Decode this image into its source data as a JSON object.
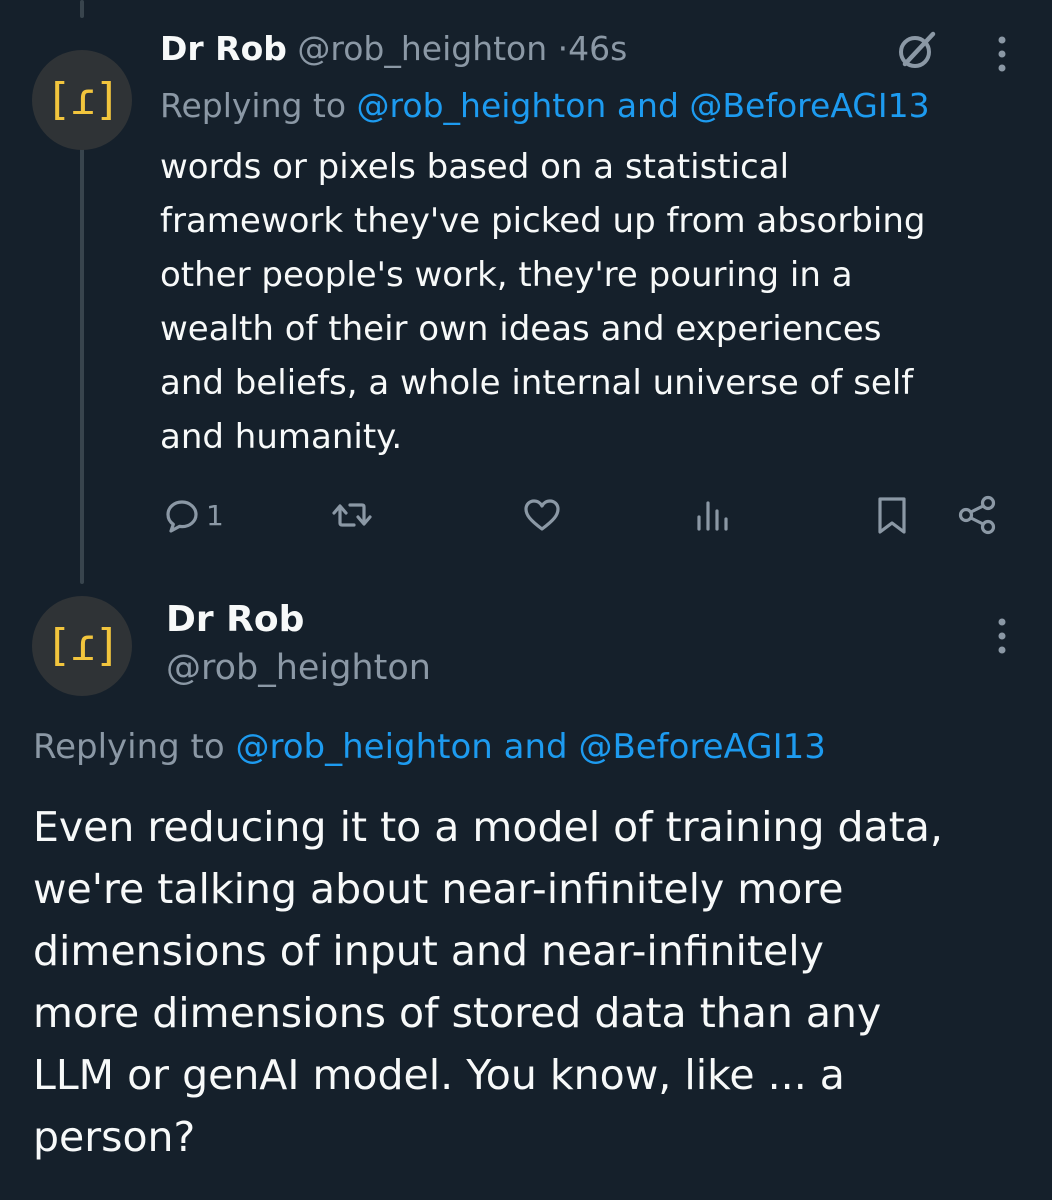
{
  "tweet1": {
    "avatar_text": "[ɾ]",
    "display_name": "Dr Rob",
    "handle": "@rob_heighton",
    "separator": "·",
    "timestamp": "46s",
    "replying_prefix": "Replying to",
    "replying_user1": "@rob_heighton",
    "replying_and": "and",
    "replying_user2": "@BeforeAGI13",
    "body_lines": [
      "words or pixels based on a statistical",
      "framework they've picked up from absorbing",
      "other people's work, they're pouring in a",
      "wealth of their own ideas and experiences",
      "and beliefs, a whole internal universe of self",
      "and humanity."
    ],
    "actions": {
      "reply_count": "1",
      "retweet_count": "",
      "like_count": "",
      "views_count": ""
    }
  },
  "tweet2": {
    "avatar_text": "[ɾ]",
    "display_name": "Dr Rob",
    "handle": "@rob_heighton",
    "replying_prefix": "Replying to",
    "replying_user1": "@rob_heighton",
    "replying_and": "and",
    "replying_user2": "@BeforeAGI13",
    "body_lines": [
      "Even reducing it to a model of training data,",
      "we're talking about near-infinitely more",
      "dimensions of input and near-infinitely",
      "more dimensions of stored data than any",
      "LLM or genAI model. You know, like ... a",
      "person?"
    ]
  },
  "icons": {
    "grok": "grok-icon",
    "more": "more-vertical-icon",
    "reply": "reply-icon",
    "retweet": "retweet-icon",
    "like": "heart-icon",
    "views": "views-icon",
    "bookmark": "bookmark-icon",
    "share": "share-icon"
  },
  "colors": {
    "background": "#15202b",
    "text": "#f7f9f9",
    "muted": "#8b98a5",
    "link": "#1d9bf0",
    "avatar_mark": "#f2c53d"
  }
}
